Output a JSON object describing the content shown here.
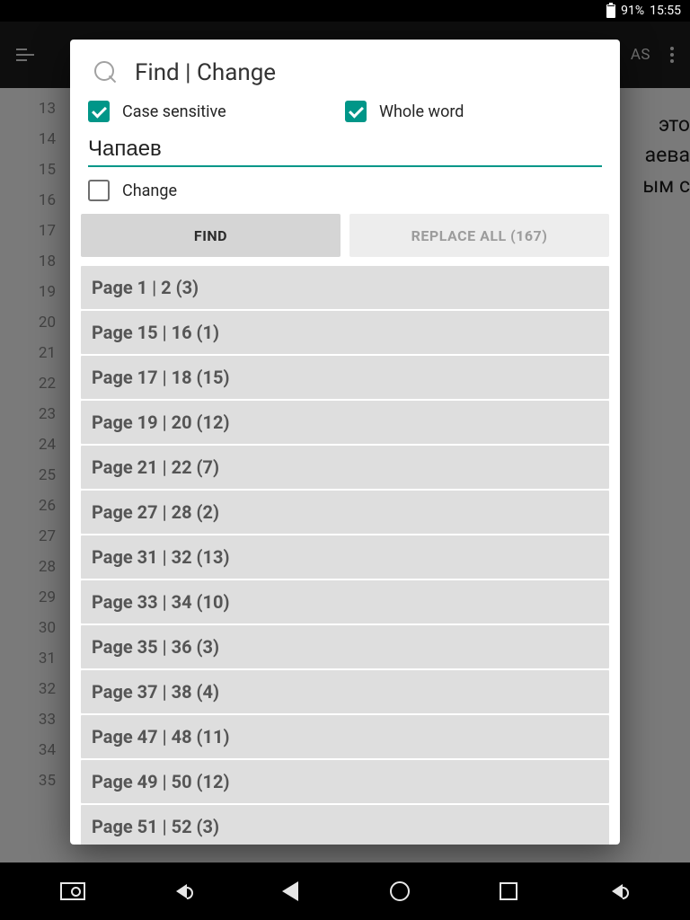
{
  "status": {
    "battery_pct": "91%",
    "clock": "15:55"
  },
  "appbar": {
    "right_text": "AS"
  },
  "background": {
    "line_start": 13,
    "line_end": 35,
    "peek_lines": [
      "это",
      "аева",
      "ым с"
    ]
  },
  "dialog": {
    "title": "Find | Change",
    "case_sensitive_label": "Case sensitive",
    "case_sensitive_checked": true,
    "whole_word_label": "Whole word",
    "whole_word_checked": true,
    "search_value": "Чапаев",
    "change_label": "Change",
    "change_checked": false,
    "find_btn": "FIND",
    "replace_btn": "REPLACE ALL (167)",
    "results": [
      "Page 1 | 2 (3)",
      "Page 15 | 16 (1)",
      "Page 17 | 18 (15)",
      "Page 19 | 20 (12)",
      "Page 21 | 22 (7)",
      "Page 27 | 28 (2)",
      "Page 31 | 32 (13)",
      "Page 33 | 34 (10)",
      "Page 35 | 36 (3)",
      "Page 37 | 38 (4)",
      "Page 47 | 48 (11)",
      "Page 49 | 50 (12)",
      "Page 51 | 52 (3)"
    ]
  }
}
